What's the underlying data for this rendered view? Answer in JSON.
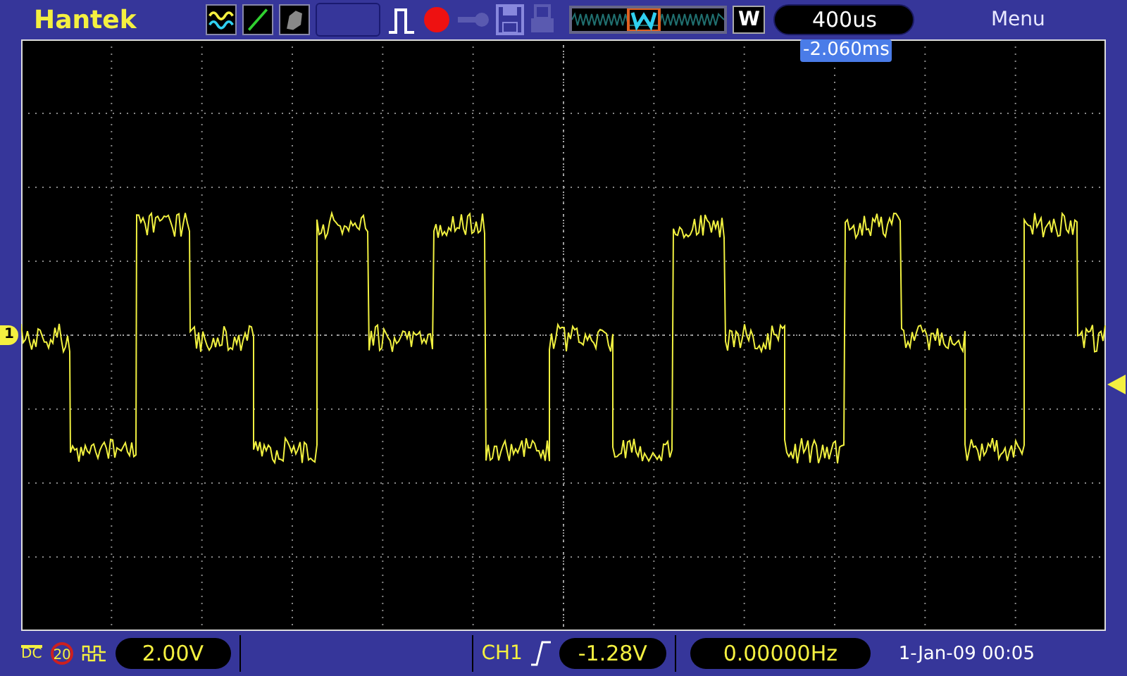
{
  "top_bar": {
    "brand": "Hantek",
    "zoom_label": "W",
    "time_base": "400us",
    "menu": "Menu"
  },
  "screen": {
    "trigger_position": "-2.060ms",
    "channel_marker": "1"
  },
  "status_bar": {
    "coupling": "DC",
    "bandwidth_limit": "20",
    "volts_per_div": "2.00V",
    "trigger_source": "CH1",
    "trigger_level": "-1.28V",
    "frequency": "0.00000Hz",
    "datetime": "1-Jan-09 00:05"
  }
}
